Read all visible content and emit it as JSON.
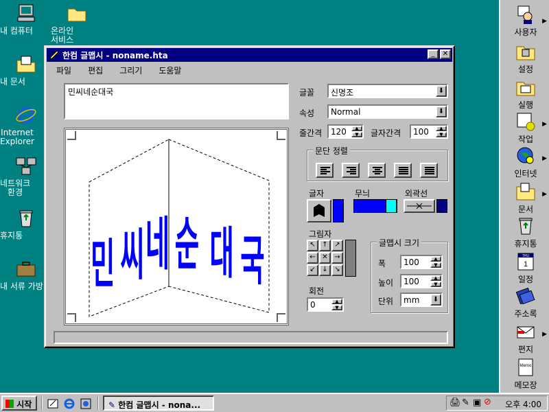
{
  "desktop": {
    "icons": [
      {
        "label": "내 컴퓨터",
        "icon": "my-computer-icon"
      },
      {
        "label": "온라인\n서비스",
        "icon": "folder-icon"
      },
      {
        "label": "내 문서",
        "icon": "my-documents-icon"
      },
      {
        "label": "Internet\nExplorer",
        "icon": "internet-explorer-icon"
      },
      {
        "label": "네트워크\n환경",
        "icon": "network-icon"
      },
      {
        "label": "휴지통",
        "icon": "recycle-bin-icon"
      },
      {
        "label": "내 서류 가방",
        "icon": "briefcase-icon"
      }
    ]
  },
  "quickbar": {
    "items": [
      {
        "label": "사용자",
        "icon": "user-icon"
      },
      {
        "label": "설정",
        "icon": "settings-icon"
      },
      {
        "label": "실행",
        "icon": "run-icon"
      },
      {
        "label": "작업",
        "icon": "task-icon"
      },
      {
        "label": "인터넷",
        "icon": "internet-icon"
      },
      {
        "label": "문서",
        "icon": "documents-icon"
      },
      {
        "label": "휴지통",
        "icon": "recycle-bin-icon"
      },
      {
        "label": "일정",
        "icon": "calendar-icon"
      },
      {
        "label": "주소록",
        "icon": "address-book-icon"
      },
      {
        "label": "편지",
        "icon": "mail-icon"
      },
      {
        "label": "메모장",
        "icon": "memo-icon"
      }
    ],
    "calendar_month": "THU",
    "calendar_day": "1",
    "memo_text": "Memo"
  },
  "window": {
    "title": "한컴 글맵시 - noname.hta",
    "menu": [
      "파일",
      "편집",
      "그리기",
      "도움말"
    ],
    "text_input": "민씨네순대국",
    "preview_text": "민씨네순대국",
    "font_label": "글꼴",
    "font_value": "신명조",
    "style_label": "속성",
    "style_value": "Normal",
    "line_spacing_label": "줄간격",
    "line_spacing_value": "120",
    "char_spacing_label": "글자간격",
    "char_spacing_value": "100",
    "align_group_label": "문단 정렬",
    "text_label": "글자",
    "pattern_label": "무늬",
    "outline_label": "외곽선",
    "shadow_label": "그림자",
    "rotate_label": "회전",
    "rotate_value": "0",
    "size_group_label": "글맵시 크기",
    "width_label": "폭",
    "width_value": "100",
    "height_label": "높이",
    "height_value": "100",
    "unit_label": "단위",
    "unit_value": "mm",
    "colors": {
      "text": "#0000ff",
      "pattern": "#0000ff",
      "pattern2": "#00ffff",
      "outline": "#000080"
    }
  },
  "taskbar": {
    "start_label": "시작",
    "task_label": "한컴 글맵시 - nona...",
    "clock": "오후 4:00"
  }
}
